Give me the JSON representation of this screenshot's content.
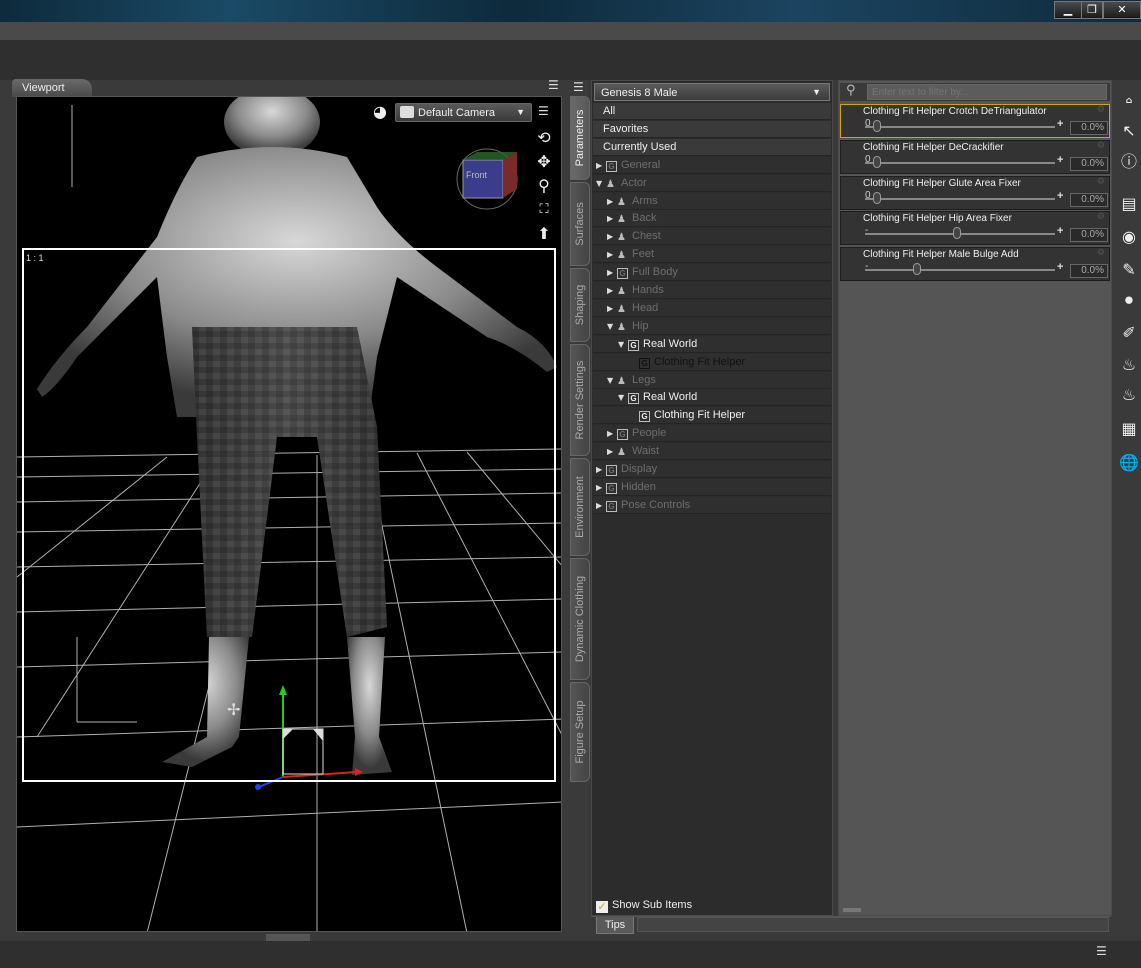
{
  "window": {
    "minimize_glyph": "▁",
    "restore_glyph": "❐",
    "close_glyph": "✕"
  },
  "viewport": {
    "tab_label": "Viewport",
    "camera": "Default Camera",
    "cube_label": "Front",
    "aspect_label": "1 : 1"
  },
  "side_tabs": [
    "Parameters",
    "Surfaces",
    "Shaping",
    "Render Settings",
    "Environment",
    "Dynamic Clothing",
    "Figure Setup"
  ],
  "figure_select": "Genesis 8 Male",
  "tree": {
    "top": [
      "All",
      "Favorites",
      "Currently Used"
    ],
    "rows": [
      {
        "label": "General",
        "arrow": "▶",
        "icon": "G",
        "indent": 0
      },
      {
        "label": "Actor",
        "arrow": "▼",
        "icon": "P",
        "indent": 0
      },
      {
        "label": "Arms",
        "arrow": "▶",
        "icon": "P",
        "indent": 1
      },
      {
        "label": "Back",
        "arrow": "▶",
        "icon": "P",
        "indent": 1
      },
      {
        "label": "Chest",
        "arrow": "▶",
        "icon": "P",
        "indent": 1
      },
      {
        "label": "Feet",
        "arrow": "▶",
        "icon": "P",
        "indent": 1
      },
      {
        "label": "Full Body",
        "arrow": "▶",
        "icon": "G",
        "indent": 1
      },
      {
        "label": "Hands",
        "arrow": "▶",
        "icon": "P",
        "indent": 1
      },
      {
        "label": "Head",
        "arrow": "▶",
        "icon": "P",
        "indent": 1
      },
      {
        "label": "Hip",
        "arrow": "▼",
        "icon": "P",
        "indent": 1
      },
      {
        "label": "Real World",
        "arrow": "▼",
        "icon": "G",
        "indent": 2
      },
      {
        "label": "Clothing Fit Helper",
        "arrow": "",
        "icon": "G",
        "indent": 3
      },
      {
        "label": "Legs",
        "arrow": "▼",
        "icon": "P",
        "indent": 1
      },
      {
        "label": "Real World",
        "arrow": "▼",
        "icon": "G",
        "indent": 2
      },
      {
        "label": "Clothing Fit Helper",
        "arrow": "",
        "icon": "G",
        "indent": 3
      },
      {
        "label": "People",
        "arrow": "▶",
        "icon": "G",
        "indent": 1
      },
      {
        "label": "Waist",
        "arrow": "▶",
        "icon": "P",
        "indent": 1
      },
      {
        "label": "Display",
        "arrow": "▶",
        "icon": "G",
        "indent": 0
      },
      {
        "label": "Hidden",
        "arrow": "▶",
        "icon": "G",
        "indent": 0
      },
      {
        "label": "Pose Controls",
        "arrow": "▶",
        "icon": "G",
        "indent": 0
      }
    ],
    "show_sub_items": "Show Sub Items"
  },
  "filter_placeholder": "Enter text to filter by...",
  "sliders": [
    {
      "label": "Clothing Fit Helper Crotch DeTriangulator",
      "value": "0.0%",
      "level": 0.0,
      "min_mark": "0"
    },
    {
      "label": "Clothing Fit Helper DeCrackifier",
      "value": "0.0%",
      "level": 0.0,
      "min_mark": "0"
    },
    {
      "label": "Clothing Fit Helper Glute Area Fixer",
      "value": "0.0%",
      "level": 0.0,
      "min_mark": "0"
    },
    {
      "label": "Clothing Fit Helper Hip Area Fixer",
      "value": "0.0%",
      "level": 0.5,
      "min_mark": "-"
    },
    {
      "label": "Clothing Fit Helper Male Bulge Add",
      "value": "0.0%",
      "level": 0.25,
      "min_mark": "-"
    }
  ],
  "tips_tab": "Tips",
  "colors": {
    "selected": "#f2b826",
    "viewport_bg": "#000000",
    "panel": "#2c2c2c"
  }
}
